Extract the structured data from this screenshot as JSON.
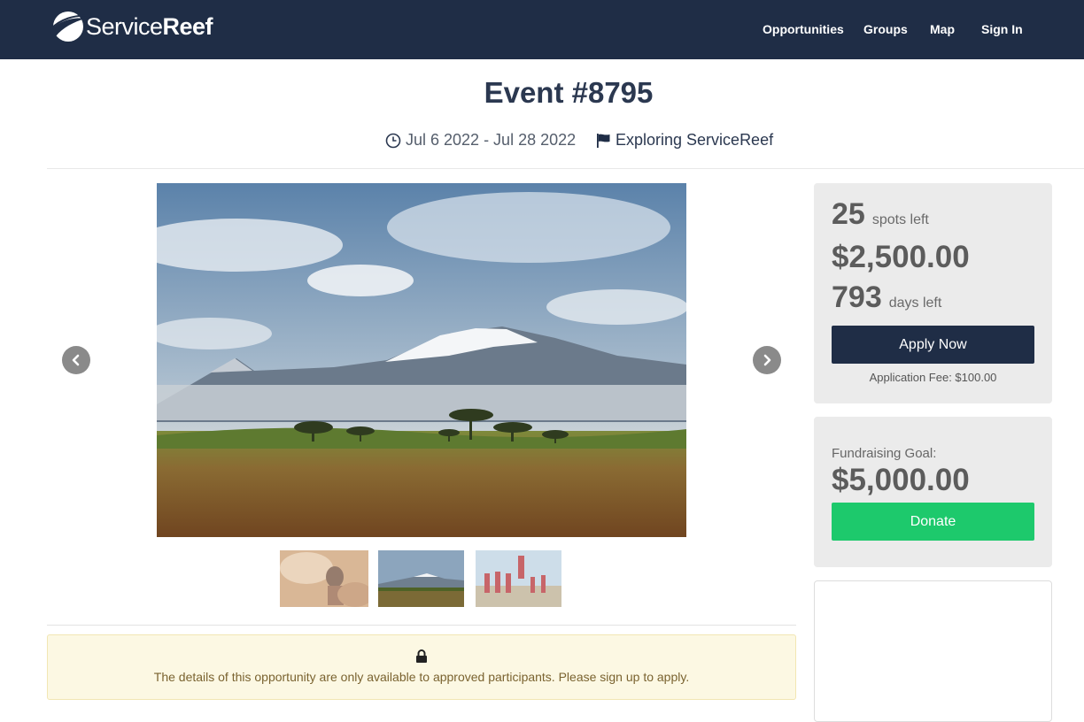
{
  "header": {
    "logo_light": "Service",
    "logo_bold": "Reef",
    "nav": [
      "Opportunities",
      "Groups",
      "Map",
      "Sign In"
    ]
  },
  "event": {
    "title": "Event #8795",
    "dates": "Jul 6 2022 - Jul 28 2022",
    "group": "Exploring ServiceReef"
  },
  "icons": {
    "logo": "wave-logo-icon",
    "date": "clock-icon",
    "group": "flag-icon",
    "prev": "chevron-left-icon",
    "next": "chevron-right-icon",
    "notice": "lock-icon"
  },
  "gallery": {
    "thumbnails": [
      "thumbnail-child-dust",
      "thumbnail-mountain",
      "thumbnail-group-jumping"
    ],
    "active_index": 1
  },
  "notice": {
    "text": "The details of this opportunity are only available to approved participants. Please sign up to apply."
  },
  "signup_panel": {
    "spots_count": "25",
    "spots_label": "spots left",
    "price": "$2,500.00",
    "days_count": "793",
    "days_label": "days left",
    "apply_label": "Apply Now",
    "fee_text": "Application Fee: $100.00"
  },
  "fundraising_panel": {
    "goal_label": "Fundraising Goal:",
    "goal_value": "$5,000.00",
    "donate_label": "Donate"
  },
  "colors": {
    "header_bg": "#1f2d46",
    "apply_bg": "#1f2d46",
    "donate_bg": "#1dc96c",
    "notice_bg": "#fcf8e3",
    "panel_bg": "#ebebeb"
  }
}
